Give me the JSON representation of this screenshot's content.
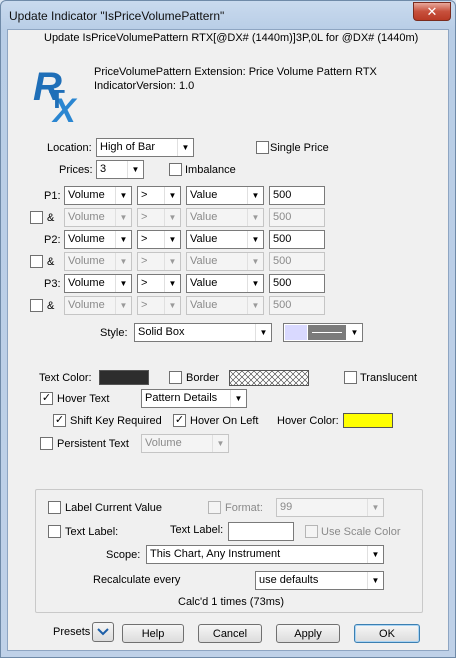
{
  "window": {
    "title": "Update Indicator \"IsPriceVolumePattern\"",
    "close_glyph": "✕"
  },
  "header": {
    "line": "Update IsPriceVolumePattern RTX[@DX# (1440m)]3P,0L for @DX# (1440m)",
    "logo_text": "RTX",
    "ext_name": "PriceVolumePattern Extension: Price Volume Pattern RTX",
    "version": "IndicatorVersion: 1.0"
  },
  "location": {
    "label": "Location:",
    "value": "High of Bar"
  },
  "single_price": {
    "label": "Single Price",
    "checked": false
  },
  "prices": {
    "label": "Prices:",
    "value": "3"
  },
  "imbalance": {
    "label": "Imbalance",
    "checked": false
  },
  "patterns": [
    {
      "label": "P1:",
      "field": "Volume",
      "op": ">",
      "type": "Value",
      "value": "500",
      "enabled": true
    },
    {
      "label": "&",
      "field": "Volume",
      "op": ">",
      "type": "Value",
      "value": "500",
      "enabled": false
    },
    {
      "label": "P2:",
      "field": "Volume",
      "op": ">",
      "type": "Value",
      "value": "500",
      "enabled": true
    },
    {
      "label": "&",
      "field": "Volume",
      "op": ">",
      "type": "Value",
      "value": "500",
      "enabled": false
    },
    {
      "label": "P3:",
      "field": "Volume",
      "op": ">",
      "type": "Value",
      "value": "500",
      "enabled": true
    },
    {
      "label": "&",
      "field": "Volume",
      "op": ">",
      "type": "Value",
      "value": "500",
      "enabled": false
    }
  ],
  "style": {
    "label": "Style:",
    "value": "Solid Box",
    "swatch_color": "#d9d9ff"
  },
  "text_color": {
    "label": "Text Color:",
    "color": "#2d2d2d"
  },
  "border": {
    "label": "Border",
    "checked": false
  },
  "translucent": {
    "label": "Translucent",
    "checked": false
  },
  "hover_text": {
    "label": "Hover Text",
    "checked": true,
    "value": "Pattern Details"
  },
  "shift_key": {
    "label": "Shift Key Required",
    "checked": true
  },
  "hover_left": {
    "label": "Hover On Left",
    "checked": true
  },
  "hover_color": {
    "label": "Hover Color:",
    "color": "#ffff00"
  },
  "persistent_text": {
    "label": "Persistent Text",
    "checked": false,
    "value": "Volume"
  },
  "label_current": {
    "label": "Label Current Value",
    "checked": false
  },
  "format": {
    "label": "Format:",
    "checked": false,
    "value": "99"
  },
  "text_label_cb": {
    "label": "Text Label:",
    "checked": false
  },
  "text_label": {
    "label": "Text Label:",
    "value": ""
  },
  "use_scale": {
    "label": "Use Scale Color",
    "checked": false
  },
  "scope": {
    "label": "Scope:",
    "value": "This Chart, Any Instrument"
  },
  "recalc": {
    "label": "Recalculate every",
    "value": "use defaults"
  },
  "calc_status": "Calc'd 1 times (73ms)",
  "footer": {
    "presets": "Presets",
    "help": "Help",
    "cancel": "Cancel",
    "apply": "Apply",
    "ok": "OK"
  },
  "check_glyph": "✓",
  "arrow_glyph": "▼"
}
